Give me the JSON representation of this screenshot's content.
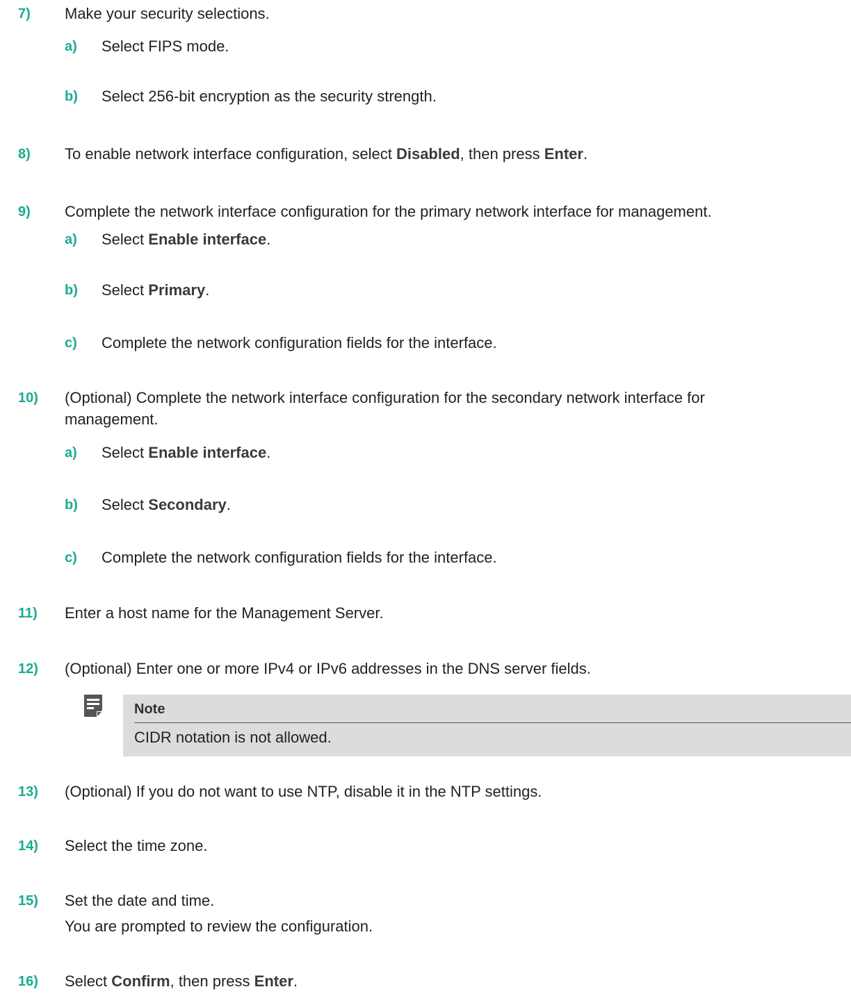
{
  "steps": [
    {
      "num": "7)",
      "text": "Make your security selections.",
      "subs": [
        {
          "num": "a)",
          "text": "Select FIPS mode."
        },
        {
          "num": "b)",
          "text": "Select 256-bit encryption as the security strength."
        }
      ]
    },
    {
      "num": "8)",
      "pre": "To enable network interface configuration, select ",
      "b1": "Disabled",
      "mid": ", then press ",
      "b2": "Enter",
      "post": "."
    },
    {
      "num": "9)",
      "text": "Complete the network interface configuration for the primary network interface for management.",
      "subs": [
        {
          "num": "a)",
          "pre": "Select ",
          "bold": "Enable interface",
          "post": "."
        },
        {
          "num": "b)",
          "pre": "Select ",
          "bold": "Primary",
          "post": "."
        },
        {
          "num": "c)",
          "text": "Complete the network configuration fields for the interface."
        }
      ]
    },
    {
      "num": "10)",
      "text_line1": "(Optional) Complete the network interface configuration for the secondary network interface for",
      "text_line2": "management.",
      "subs": [
        {
          "num": "a)",
          "pre": "Select ",
          "bold": "Enable interface",
          "post": "."
        },
        {
          "num": "b)",
          "pre": "Select ",
          "bold": "Secondary",
          "post": "."
        },
        {
          "num": "c)",
          "text": "Complete the network configuration fields for the interface."
        }
      ]
    },
    {
      "num": "11)",
      "text": "Enter a host name for the Management Server."
    },
    {
      "num": "12)",
      "text": "(Optional) Enter one or more IPv4 or IPv6 addresses in the DNS server fields."
    },
    {
      "num": "13)",
      "text": "(Optional) If you do not want to use NTP, disable it in the NTP settings."
    },
    {
      "num": "14)",
      "text": "Select the time zone."
    },
    {
      "num": "15)",
      "text": "Set the date and time.",
      "text2": "You are prompted to review the configuration."
    },
    {
      "num": "16)",
      "pre": "Select ",
      "b1": "Confirm",
      "mid": ", then press ",
      "b2": "Enter",
      "post": "."
    }
  ],
  "note": {
    "title": "Note",
    "body": "CIDR notation is not allowed.",
    "icon": "note-icon"
  },
  "colors": {
    "step_number": "#1aab91",
    "text": "#222222",
    "note_bg": "#dcdcdc",
    "note_icon": "#555555"
  }
}
